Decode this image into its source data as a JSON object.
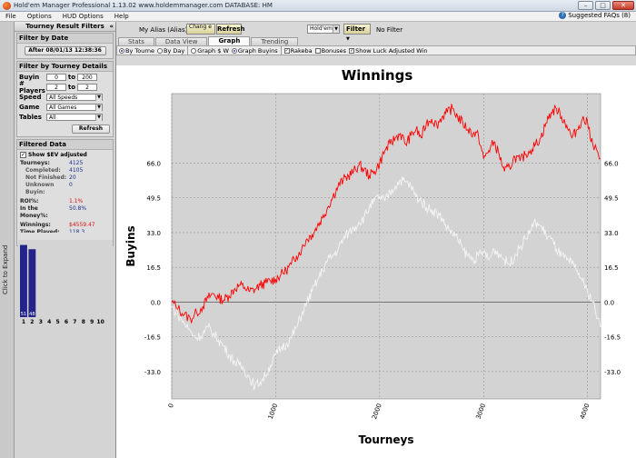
{
  "window": {
    "title": "Hold'em Manager Professional 1.13.02     www.holdemmanager.com     DATABASE: HM",
    "min": "–",
    "max": "□",
    "close": "✕"
  },
  "menu": {
    "items": [
      "File",
      "Options",
      "HUD Options",
      "Help"
    ],
    "suggested_faqs": "Suggested FAQs (8)"
  },
  "sidebar": {
    "header": "Tourney Result Filters",
    "collapse": "«",
    "expand_label": "Click to Expand",
    "filter_by_date": {
      "title": "Filter by Date",
      "button": "After 08/01/13 12:38:36"
    },
    "filter_by_details": {
      "title": "Filter by Tourney Details",
      "buyin": {
        "label": "Buyin",
        "from": "0",
        "to_label": "to",
        "to": "200"
      },
      "players": {
        "label": "# Players",
        "from": "2",
        "to_label": "to",
        "to": "2"
      },
      "speed": {
        "label": "Speed",
        "value": "All Speeds"
      },
      "game": {
        "label": "Game",
        "value": "All Games"
      },
      "tables": {
        "label": "Tables",
        "value": "All"
      },
      "refresh": "Refresh"
    },
    "filtered_data": {
      "title": "Filtered Data",
      "show_ev_label": "Show $EV adjusted",
      "show_ev_checked": "✓",
      "tourneys": {
        "label": "Tourneys:",
        "value": "4125"
      },
      "completed": {
        "label": "Completed:",
        "value": "4105"
      },
      "not_finished": {
        "label": "Not Finished:",
        "value": "20"
      },
      "unknown": {
        "label": "Unknown",
        "value": "0"
      },
      "buyin": {
        "label": "Buyin:",
        "value": ""
      },
      "roi": {
        "label": "ROI%:",
        "value": "1.1%"
      },
      "in_money_1": {
        "label": "In the",
        "value": "50.8%"
      },
      "in_money_2": {
        "label": "Money%:",
        "value": ""
      },
      "winnings": {
        "label": "Winnings:",
        "value": "$4559.47"
      },
      "time_played": {
        "label": "Time Played:",
        "value": "118.3"
      }
    },
    "mini_chart": {
      "bars": [
        {
          "label": "1",
          "value": 51
        },
        {
          "label": "2",
          "value": 48
        }
      ],
      "xticks": [
        "1",
        "2",
        "3",
        "4",
        "5",
        "6",
        "7",
        "8",
        "9",
        "10"
      ],
      "bar_color": "#23238a"
    }
  },
  "toolbar": {
    "alias_label": "My Alias (Alias)",
    "change_button": "Chang e",
    "refresh_button": "Refresh",
    "game_select": "Hold'em",
    "filter_button": "Filter",
    "filter_status": "No Filter"
  },
  "tabs": [
    {
      "label": "Stats",
      "active": false
    },
    {
      "label": "Data View",
      "active": false
    },
    {
      "label": "Graph",
      "active": true
    },
    {
      "label": "Trending",
      "active": false
    }
  ],
  "graph_options": {
    "by_tourney": "By Tourne",
    "by_day": "By Day",
    "graph_dollar": "Graph $ W",
    "graph_buyins": "Graph Buyins",
    "rakeba": "Rakeba",
    "bonuses": "Bonuses",
    "show_luck": "Show Luck Adjusted Win",
    "check_mark": "✓"
  },
  "chart_data": {
    "type": "line",
    "title": "Winnings",
    "xlabel": "Tourneys",
    "ylabel": "Buyins",
    "xlim": [
      0,
      4125
    ],
    "ylim": [
      -46,
      99
    ],
    "xticks": [
      0,
      1000,
      2000,
      3000,
      4000
    ],
    "yticks": [
      -33.0,
      -16.5,
      0.0,
      16.5,
      33.0,
      49.5,
      66.0
    ],
    "grid": true,
    "background": "#d3d3d3",
    "series": [
      {
        "color": "#ff0000",
        "x": [
          0,
          60,
          120,
          180,
          240,
          300,
          350,
          400,
          450,
          500,
          550,
          600,
          650,
          700,
          750,
          800,
          850,
          900,
          950,
          1000,
          1050,
          1100,
          1150,
          1200,
          1250,
          1300,
          1350,
          1400,
          1450,
          1500,
          1550,
          1600,
          1650,
          1700,
          1750,
          1800,
          1850,
          1900,
          1950,
          2000,
          2050,
          2100,
          2150,
          2200,
          2250,
          2300,
          2350,
          2400,
          2450,
          2500,
          2550,
          2600,
          2650,
          2700,
          2750,
          2800,
          2850,
          2900,
          2950,
          3000,
          3050,
          3100,
          3150,
          3200,
          3250,
          3300,
          3350,
          3400,
          3450,
          3500,
          3550,
          3600,
          3650,
          3700,
          3750,
          3800,
          3850,
          3900,
          3950,
          4000,
          4050,
          4125
        ],
        "y": [
          0,
          -3,
          -6,
          -8,
          -5,
          -2,
          2,
          4,
          2,
          1,
          3,
          6,
          8,
          7,
          5,
          6,
          8,
          9,
          10,
          11,
          13,
          15,
          18,
          22,
          25,
          30,
          32,
          36,
          40,
          45,
          50,
          55,
          58,
          60,
          62,
          65,
          63,
          60,
          62,
          66,
          72,
          75,
          78,
          80,
          75,
          79,
          82,
          78,
          85,
          87,
          84,
          88,
          90,
          92,
          88,
          85,
          82,
          80,
          79,
          68,
          72,
          76,
          70,
          62,
          64,
          69,
          67,
          70,
          72,
          75,
          78,
          85,
          90,
          92,
          88,
          84,
          78,
          82,
          87,
          85,
          75,
          68
        ]
      },
      {
        "color": "#f4f4f4",
        "x": [
          0,
          60,
          120,
          180,
          240,
          300,
          350,
          400,
          450,
          500,
          550,
          600,
          650,
          700,
          750,
          800,
          850,
          900,
          950,
          1000,
          1050,
          1100,
          1150,
          1200,
          1250,
          1300,
          1350,
          1400,
          1450,
          1500,
          1550,
          1600,
          1650,
          1700,
          1750,
          1800,
          1850,
          1900,
          1950,
          2000,
          2050,
          2100,
          2150,
          2200,
          2250,
          2300,
          2350,
          2400,
          2450,
          2500,
          2550,
          2600,
          2650,
          2700,
          2750,
          2800,
          2850,
          2900,
          2950,
          3000,
          3050,
          3100,
          3150,
          3200,
          3250,
          3300,
          3350,
          3400,
          3450,
          3500,
          3550,
          3600,
          3650,
          3700,
          3750,
          3800,
          3850,
          3900,
          3950,
          4000,
          4050,
          4125
        ],
        "y": [
          -2,
          -6,
          -10,
          -14,
          -17,
          -15,
          -12,
          -15,
          -18,
          -21,
          -25,
          -28,
          -30,
          -32,
          -36,
          -40,
          -38,
          -35,
          -30,
          -25,
          -22,
          -20,
          -17,
          -12,
          -6,
          0,
          5,
          10,
          15,
          20,
          22,
          25,
          30,
          33,
          35,
          38,
          40,
          45,
          48,
          50,
          48,
          52,
          55,
          58,
          57,
          55,
          50,
          48,
          45,
          44,
          42,
          40,
          35,
          33,
          30,
          25,
          22,
          20,
          22,
          24,
          20,
          25,
          23,
          20,
          18,
          22,
          26,
          30,
          34,
          38,
          36,
          32,
          30,
          25,
          22,
          20,
          18,
          15,
          10,
          5,
          0,
          -12
        ]
      }
    ]
  }
}
